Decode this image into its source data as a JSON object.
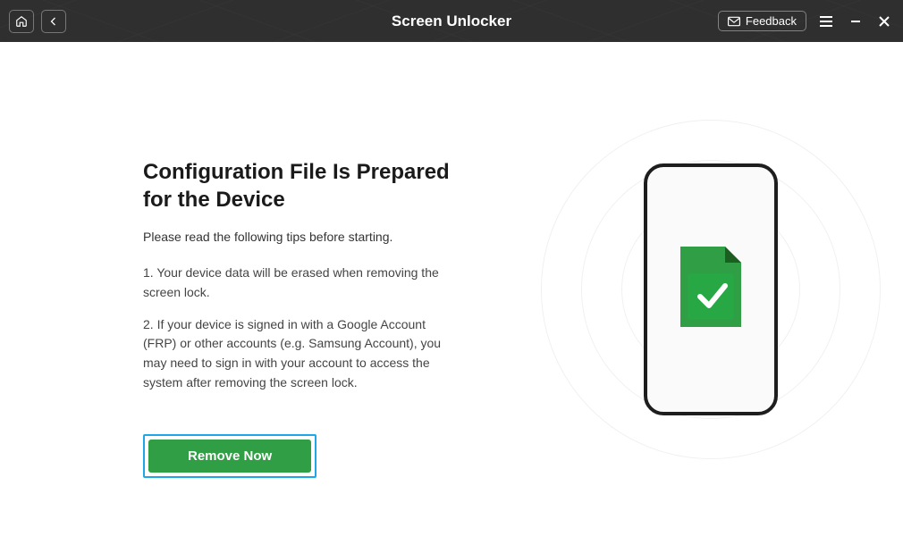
{
  "titlebar": {
    "title": "Screen Unlocker",
    "feedback_label": "Feedback"
  },
  "main": {
    "heading": "Configuration File Is Prepared for the Device",
    "subhead": "Please read the following tips before starting.",
    "tips": [
      "1. Your device data will be erased when removing the screen lock.",
      "2. If your device is signed in with a Google Account (FRP) or other accounts (e.g. Samsung Account), you may need to sign in with your account to access the system after removing the screen lock."
    ],
    "remove_label": "Remove Now"
  },
  "colors": {
    "accent_green": "#2f9e44",
    "highlight_blue": "#1ea7e8"
  }
}
